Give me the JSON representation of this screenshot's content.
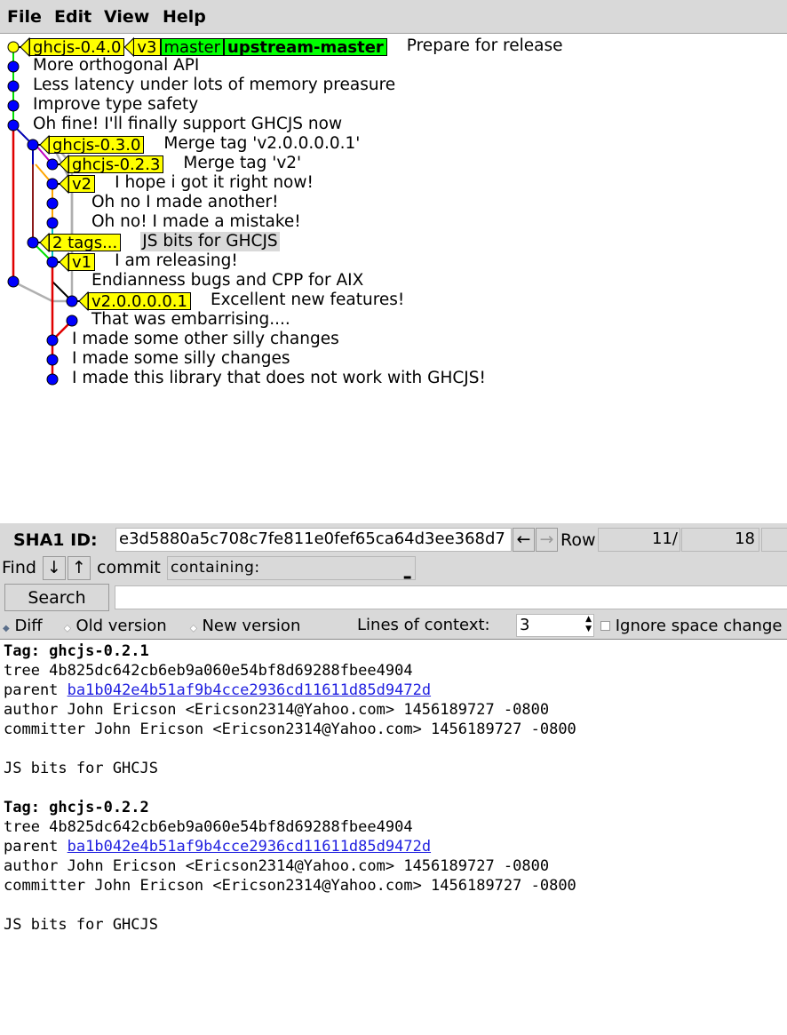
{
  "menu": [
    "File",
    "Edit",
    "View",
    "Help"
  ],
  "commits": [
    {
      "msg": "Prepare for release",
      "refs": [
        {
          "name": "ghcjs-0.4.0",
          "kind": "tag"
        },
        {
          "name": "v3",
          "kind": "tag"
        },
        {
          "name": "master",
          "kind": "head"
        },
        {
          "name": "upstream-master",
          "kind": "head-bold"
        }
      ]
    },
    {
      "msg": "More orthogonal API",
      "refs": []
    },
    {
      "msg": "Less latency under lots of memory preasure",
      "refs": []
    },
    {
      "msg": "Improve type safety",
      "refs": []
    },
    {
      "msg": "Oh fine! I'll finally support GHCJS now",
      "refs": []
    },
    {
      "msg": "Merge tag 'v2.0.0.0.0.1'",
      "refs": [
        {
          "name": "ghcjs-0.3.0",
          "kind": "tag"
        }
      ]
    },
    {
      "msg": "Merge tag 'v2'",
      "refs": [
        {
          "name": "ghcjs-0.2.3",
          "kind": "tag"
        }
      ]
    },
    {
      "msg": "I hope i got it right now!",
      "refs": [
        {
          "name": "v2",
          "kind": "tag"
        }
      ]
    },
    {
      "msg": "Oh no I made another!",
      "refs": []
    },
    {
      "msg": "Oh no! I made a mistake!",
      "refs": []
    },
    {
      "msg": "JS bits for GHCJS",
      "refs": [
        {
          "name": "2 tags...",
          "kind": "tag"
        }
      ],
      "selected": true
    },
    {
      "msg": "I am releasing!",
      "refs": [
        {
          "name": "v1",
          "kind": "tag"
        }
      ]
    },
    {
      "msg": "Endianness bugs and CPP for AIX",
      "refs": []
    },
    {
      "msg": "Excellent new features!",
      "refs": [
        {
          "name": "v2.0.0.0.0.1",
          "kind": "tag"
        }
      ]
    },
    {
      "msg": "That was embarrising....",
      "refs": []
    },
    {
      "msg": "I made some other silly changes",
      "refs": []
    },
    {
      "msg": "I made some silly changes",
      "refs": []
    },
    {
      "msg": "I made this library that does not work with GHCJS!",
      "refs": []
    }
  ],
  "sha": {
    "label": "SHA1 ID:",
    "value": "e3d5880a5c708c7fe811e0fef65ca64d3ee368d7",
    "back": "←",
    "forward": "→",
    "row_label": "Row",
    "row": "11/",
    "total": "18"
  },
  "find": {
    "label": "Find",
    "down": "↓",
    "up": "↑",
    "type": "commit",
    "mode": "containing:",
    "value": ""
  },
  "search": {
    "button": "Search",
    "value": ""
  },
  "options": {
    "diff": "Diff",
    "old": "Old version",
    "new": "New version",
    "context_label": "Lines of context:",
    "context": "3",
    "ignore": "Ignore space change"
  },
  "diff": {
    "blocks": [
      {
        "tag_label": "Tag: ",
        "tag": "ghcjs-0.2.1",
        "tree": "tree 4b825dc642cb6eb9a060e54bf8d69288fbee4904",
        "parent_label": "parent ",
        "parent": "ba1b042e4b51af9b4cce2936cd11611d85d9472d",
        "author": "author John Ericson <Ericson2314@Yahoo.com> 1456189727 -0800",
        "committer": "committer John Ericson <Ericson2314@Yahoo.com> 1456189727 -0800",
        "message": "JS bits for GHCJS"
      },
      {
        "tag_label": "Tag: ",
        "tag": "ghcjs-0.2.2",
        "tree": "tree 4b825dc642cb6eb9a060e54bf8d69288fbee4904",
        "parent_label": "parent ",
        "parent": "ba1b042e4b51af9b4cce2936cd11611d85d9472d",
        "author": "author John Ericson <Ericson2314@Yahoo.com> 1456189727 -0800",
        "committer": "committer John Ericson <Ericson2314@Yahoo.com> 1456189727 -0800",
        "message": "JS bits for GHCJS"
      }
    ]
  },
  "colors": {
    "tag": "#ffff00",
    "head": "#00ff00",
    "node": "#0000ff",
    "head_node": "#ffff00",
    "link": "#1f1fe0"
  }
}
